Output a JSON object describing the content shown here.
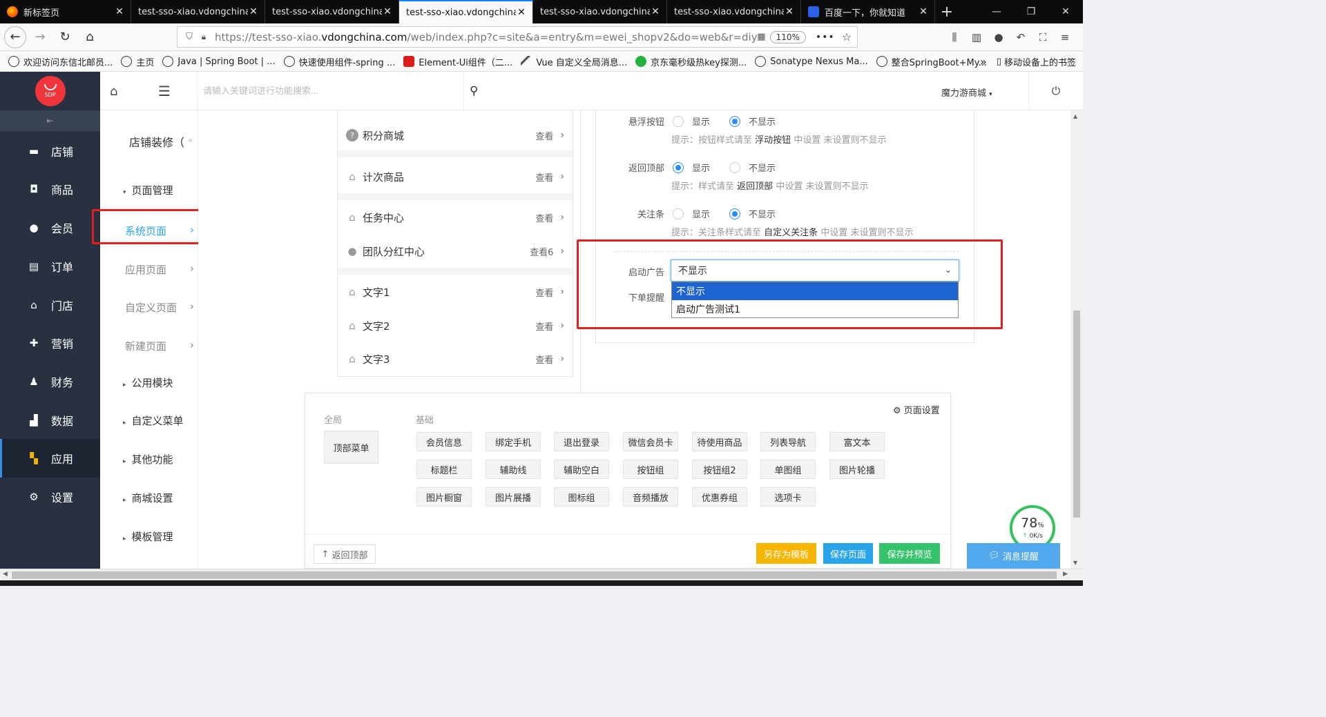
{
  "browser": {
    "tabs": [
      {
        "label": "新标签页",
        "icon": "firefox-icon",
        "active": false
      },
      {
        "label": "test-sso-xiao.vdongchina.c",
        "active": false
      },
      {
        "label": "test-sso-xiao.vdongchina.c",
        "active": false
      },
      {
        "label": "test-sso-xiao.vdongchina.c",
        "active": true
      },
      {
        "label": "test-sso-xiao.vdongchina.c",
        "active": false
      },
      {
        "label": "test-sso-xiao.vdongchina.c",
        "active": false
      },
      {
        "label": "百度一下，你就知道",
        "icon": "baidu-icon",
        "active": false
      }
    ],
    "url_prefix": "https://test-sso-xiao.",
    "url_domain": "vdongchina.com",
    "url_rest": "/web/index.php?c=site&a=entry&m=ewei_shopv2&do=web&r=diypage.pag",
    "zoom": "110%",
    "bookmarks": [
      "欢迎访问东信北邮员...",
      "主页",
      "Java | Spring Boot | ...",
      "快速使用组件-spring ...",
      "Element-Ui组件（二...",
      "Vue 自定义全局消息...",
      "京东毫秒级热key探测...",
      "Sonatype Nexus Ma...",
      "整合SpringBoot+My..."
    ],
    "mobile_bookmarks": "移动设备上的书签"
  },
  "app": {
    "logo_text": "SDP",
    "search_placeholder": "请输入关键词进行功能搜索...",
    "shop_name": "魔力游商城",
    "main_nav": [
      {
        "label": "店铺",
        "icon": "store-icon"
      },
      {
        "label": "商品",
        "icon": "goods-icon"
      },
      {
        "label": "会员",
        "icon": "member-icon"
      },
      {
        "label": "订单",
        "icon": "order-icon"
      },
      {
        "label": "门店",
        "icon": "shop-icon"
      },
      {
        "label": "营销",
        "icon": "gift-icon"
      },
      {
        "label": "财务",
        "icon": "finance-icon"
      },
      {
        "label": "数据",
        "icon": "chart-icon"
      },
      {
        "label": "应用",
        "icon": "apps-icon",
        "active": true
      },
      {
        "label": "设置",
        "icon": "gear-icon"
      }
    ],
    "sub_title": "店铺装修（",
    "sub_nav": {
      "page_mgmt": "页面管理",
      "system_pages": "系统页面",
      "app_pages": "应用页面",
      "custom_pages": "自定义页面",
      "new_page": "新建页面",
      "public_modules": "公用模块",
      "custom_menu": "自定义菜单",
      "other_functions": "其他功能",
      "mall_settings": "商城设置",
      "template_mgmt": "模板管理"
    }
  },
  "phone_list": [
    {
      "label": "积分商城",
      "value": "查看"
    },
    {
      "label": "计次商品",
      "value": "查看"
    },
    {
      "label": "任务中心",
      "value": "查看"
    },
    {
      "label": "团队分红中心",
      "value": "查看6"
    },
    {
      "label": "文字1",
      "value": "查看"
    },
    {
      "label": "文字2",
      "value": "查看"
    },
    {
      "label": "文字3",
      "value": "查看"
    }
  ],
  "settings": {
    "float_button": {
      "label": "悬浮按钮",
      "selected": "不显示",
      "hint_pre": "提示：按钮样式请至",
      "hint_link": "浮动按钮",
      "hint_post": "中设置 未设置则不显示"
    },
    "back_top": {
      "label": "返回顶部",
      "selected": "显示",
      "hint_pre": "提示：样式请至",
      "hint_link": "返回顶部",
      "hint_post": "中设置 未设置则不显示"
    },
    "follow_bar": {
      "label": "关注条",
      "selected": "不显示",
      "hint_pre": "提示：关注条样式请至",
      "hint_link": "自定义关注条",
      "hint_post": "中设置 未设置则不显示"
    },
    "opt_show": "显示",
    "opt_hide": "不显示",
    "launch_ad": {
      "label": "启动广告",
      "value": "不显示",
      "options": [
        "不显示",
        "启动广告测试1"
      ]
    },
    "order_reminder": {
      "label": "下单提醒"
    }
  },
  "widgets": {
    "global_title": "全局",
    "basic_title": "基础",
    "page_setting": "页面设置",
    "global_items": [
      "顶部菜单"
    ],
    "basic_items": [
      "会员信息",
      "绑定手机",
      "退出登录",
      "微信会员卡",
      "待使用商品",
      "列表导航",
      "富文本",
      "标题栏",
      "辅助线",
      "辅助空白",
      "按钮组",
      "按钮组2",
      "单图组",
      "图片轮播",
      "图片橱窗",
      "图片展播",
      "图标组",
      "音频播放",
      "优惠券组",
      "选项卡"
    ],
    "back_to_top": "返回顶部",
    "save_as_template": "另存为模板",
    "save_page": "保存页面",
    "save_and_preview": "保存并预览"
  },
  "overlay": {
    "gauge_value": "78",
    "gauge_unit": "%",
    "gauge_speed": "0K/s",
    "message_button": "消息提醒"
  }
}
